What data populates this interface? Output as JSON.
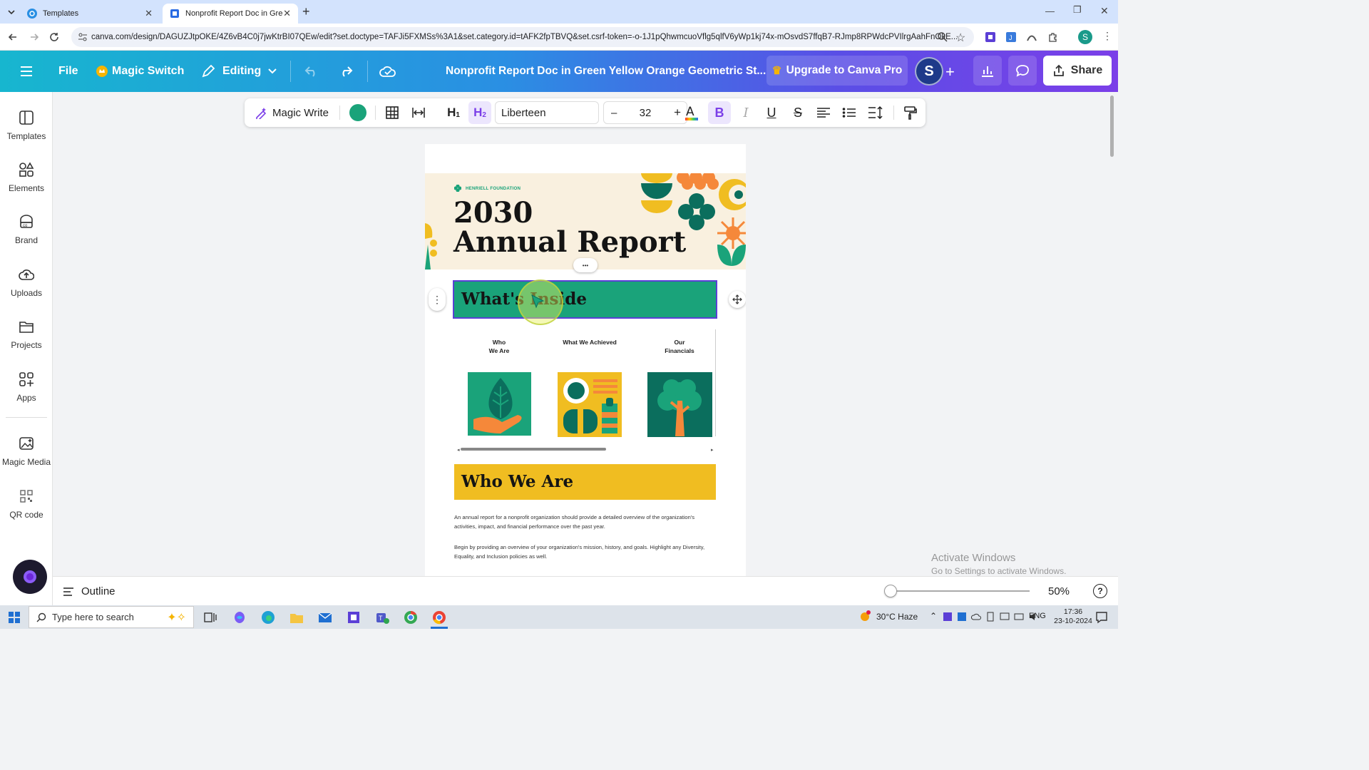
{
  "browser": {
    "tabs": [
      {
        "title": "Templates",
        "active": false
      },
      {
        "title": "Nonprofit Report Doc in Green",
        "active": true
      }
    ],
    "url": "canva.com/design/DAGUZJtpOKE/4Z6vB4C0j7jwKtrBI07QEw/edit?set.doctype=TAFJi5FXMSs%3A1&set.category.id=tAFK2fpTBVQ&set.csrf-token=-o-1J1pQhwmcuoVflg5qlfV6yWp1kj74x-mOsvdS7ffqB7-RJmp8RPWdcPVIlrgAahFnOkE...",
    "profile_initial": "S"
  },
  "header": {
    "file": "File",
    "magic_switch": "Magic Switch",
    "editing": "Editing",
    "doc_title": "Nonprofit Report Doc in Green Yellow Orange Geometric St...",
    "upgrade": "Upgrade to Canva Pro",
    "avatar": "S",
    "share": "Share"
  },
  "sidebar": {
    "items": [
      {
        "label": "Templates"
      },
      {
        "label": "Elements"
      },
      {
        "label": "Brand"
      },
      {
        "label": "Uploads"
      },
      {
        "label": "Projects"
      },
      {
        "label": "Apps"
      },
      {
        "label": "Magic Media"
      },
      {
        "label": "QR code"
      }
    ]
  },
  "toolbar": {
    "magic_write": "Magic Write",
    "font": "Liberteen",
    "font_size": "32",
    "minus": "–",
    "plus": "+",
    "h1": "H",
    "h1_sub": "1",
    "h2": "H",
    "h2_sub": "2",
    "bold": "B",
    "italic": "I",
    "underline": "U",
    "strike": "S",
    "color": "#1aa37a"
  },
  "doc": {
    "org": "HENRIELL FOUNDATION",
    "year": "2030",
    "title": "Annual Report",
    "inside_heading": "What's Inside",
    "columns": [
      {
        "line1": "Who",
        "line2": "We Are"
      },
      {
        "line1": "What We Achieved",
        "line2": ""
      },
      {
        "line1": "Our",
        "line2": "Financials"
      }
    ],
    "who_heading": "Who We Are",
    "para1": "An annual report for a nonprofit organization should provide a detailed overview of the organization's activities, impact, and financial performance over the past year.",
    "para2": "Begin by providing an overview of your organization's mission, history, and goals. Highlight any Diversity, Equality, and Inclusion policies as well.",
    "more_dots": "•••",
    "colors": {
      "green": "#1aa37a",
      "yellow": "#f0bd21",
      "dark_green": "#0b6e5d",
      "orange": "#f5883a",
      "cream": "#f9f0df"
    }
  },
  "bottom": {
    "outline": "Outline",
    "zoom": "50%",
    "help": "?",
    "watermark1": "Activate Windows",
    "watermark2": "Go to Settings to activate Windows."
  },
  "taskbar": {
    "search_placeholder": "Type here to search",
    "weather": "30°C  Haze",
    "lang": "ENG",
    "time": "17:36",
    "date": "23-10-2024"
  }
}
